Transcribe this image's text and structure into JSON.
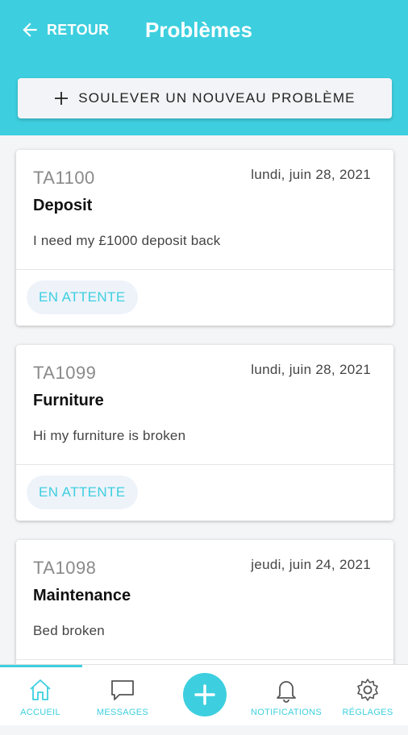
{
  "header": {
    "back_label": "RETOUR",
    "title": "Problèmes",
    "new_issue_label": "SOULEVER UN NOUVEAU PROBLÈME"
  },
  "issues": [
    {
      "id": "TA1100",
      "date": "lundi, juin 28, 2021",
      "subject": "Deposit",
      "description": "I need my £1000 deposit back",
      "status": "EN ATTENTE"
    },
    {
      "id": "TA1099",
      "date": "lundi, juin 28, 2021",
      "subject": "Furniture",
      "description": "Hi my furniture is broken",
      "status": "EN ATTENTE"
    },
    {
      "id": "TA1098",
      "date": "jeudi, juin 24, 2021",
      "subject": "Maintenance",
      "description": "Bed broken",
      "status": ""
    }
  ],
  "nav": {
    "home": "ACCUEIL",
    "messages": "MESSAGES",
    "notifications": "NOTIFICATIONS",
    "settings": "RÉGLAGES",
    "active": "home"
  },
  "colors": {
    "accent": "#3dcfdf",
    "nav_inactive": "#7a7a7a"
  }
}
